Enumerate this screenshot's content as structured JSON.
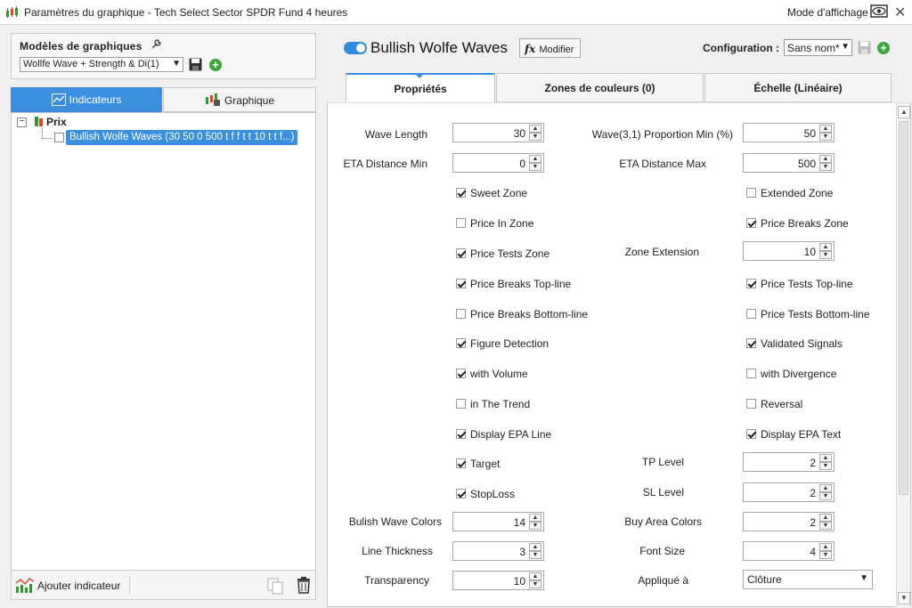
{
  "window": {
    "title": "Paramètres du graphique - Tech Select Sector SPDR Fund 4 heures",
    "display_mode": "Mode d'affichage",
    "close": "✕"
  },
  "models": {
    "label": "Modèles de graphiques",
    "selected": "Wollfe Wave + Strength & Di(1)",
    "add": "+"
  },
  "left_tabs": {
    "indicators": "Indicateurs",
    "chart": "Graphique"
  },
  "tree": {
    "expander": "−",
    "root": "Prix",
    "item": "Bullish Wolfe Waves (30 50 0 500 t f f t t 10 t t f...)"
  },
  "left_footer": {
    "add_indicator": "Ajouter indicateur"
  },
  "indicator": {
    "title": "Bullish Wolfe Waves",
    "modify": "Modifier",
    "fx": "fx",
    "config_label": "Configuration :",
    "config_value": "Sans nom*",
    "add": "+"
  },
  "tabs": [
    "Propriétés",
    "Zones de couleurs (0)",
    "Échelle (Linéaire)"
  ],
  "spinners": {
    "wave_length": {
      "label": "Wave Length",
      "value": "30"
    },
    "wave_prop": {
      "label": "Wave(3,1) Proportion Min (%)",
      "value": "50"
    },
    "eta_min": {
      "label": "ETA Distance Min",
      "value": "0"
    },
    "eta_max": {
      "label": "ETA Distance Max",
      "value": "500"
    },
    "zone_ext": {
      "label": "Zone Extension",
      "value": "10"
    },
    "tp_level": {
      "label": "TP Level",
      "value": "2"
    },
    "sl_level": {
      "label": "SL Level",
      "value": "2"
    },
    "bull_colors": {
      "label": "Bulish Wave Colors",
      "value": "14"
    },
    "buy_colors": {
      "label": "Buy Area Colors",
      "value": "2"
    },
    "thickness": {
      "label": "Line Thickness",
      "value": "3"
    },
    "font_size": {
      "label": "Font Size",
      "value": "4"
    },
    "transparency": {
      "label": "Transparency",
      "value": "10"
    }
  },
  "applied": {
    "label": "Appliqué à",
    "value": "Clôture"
  },
  "checks": {
    "sweet_zone": {
      "label": "Sweet Zone",
      "checked": true
    },
    "extended_zone": {
      "label": "Extended Zone",
      "checked": false
    },
    "price_in_zone": {
      "label": "Price In Zone",
      "checked": false
    },
    "price_breaks_zone": {
      "label": "Price Breaks Zone",
      "checked": true
    },
    "price_tests_zone": {
      "label": "Price Tests Zone",
      "checked": true
    },
    "price_breaks_top": {
      "label": "Price Breaks Top-line",
      "checked": true
    },
    "price_tests_top": {
      "label": "Price Tests Top-line",
      "checked": true
    },
    "price_breaks_bottom": {
      "label": "Price Breaks Bottom-line",
      "checked": false
    },
    "price_tests_bottom": {
      "label": "Price Tests Bottom-line",
      "checked": false
    },
    "figure_detection": {
      "label": "Figure Detection",
      "checked": true
    },
    "validated_signals": {
      "label": "Validated Signals",
      "checked": true
    },
    "with_volume": {
      "label": "with Volume",
      "checked": true
    },
    "with_divergence": {
      "label": "with Divergence",
      "checked": false
    },
    "in_trend": {
      "label": "in The Trend",
      "checked": false
    },
    "reversal": {
      "label": "Reversal",
      "checked": false
    },
    "display_epa_line": {
      "label": "Display EPA Line",
      "checked": true
    },
    "display_epa_text": {
      "label": "Display EPA Text",
      "checked": true
    },
    "target": {
      "label": "Target",
      "checked": true
    },
    "stoploss": {
      "label": "StopLoss",
      "checked": true
    }
  },
  "colors": {
    "accent": "#3a8fe0",
    "add_green": "#3aa83a"
  }
}
